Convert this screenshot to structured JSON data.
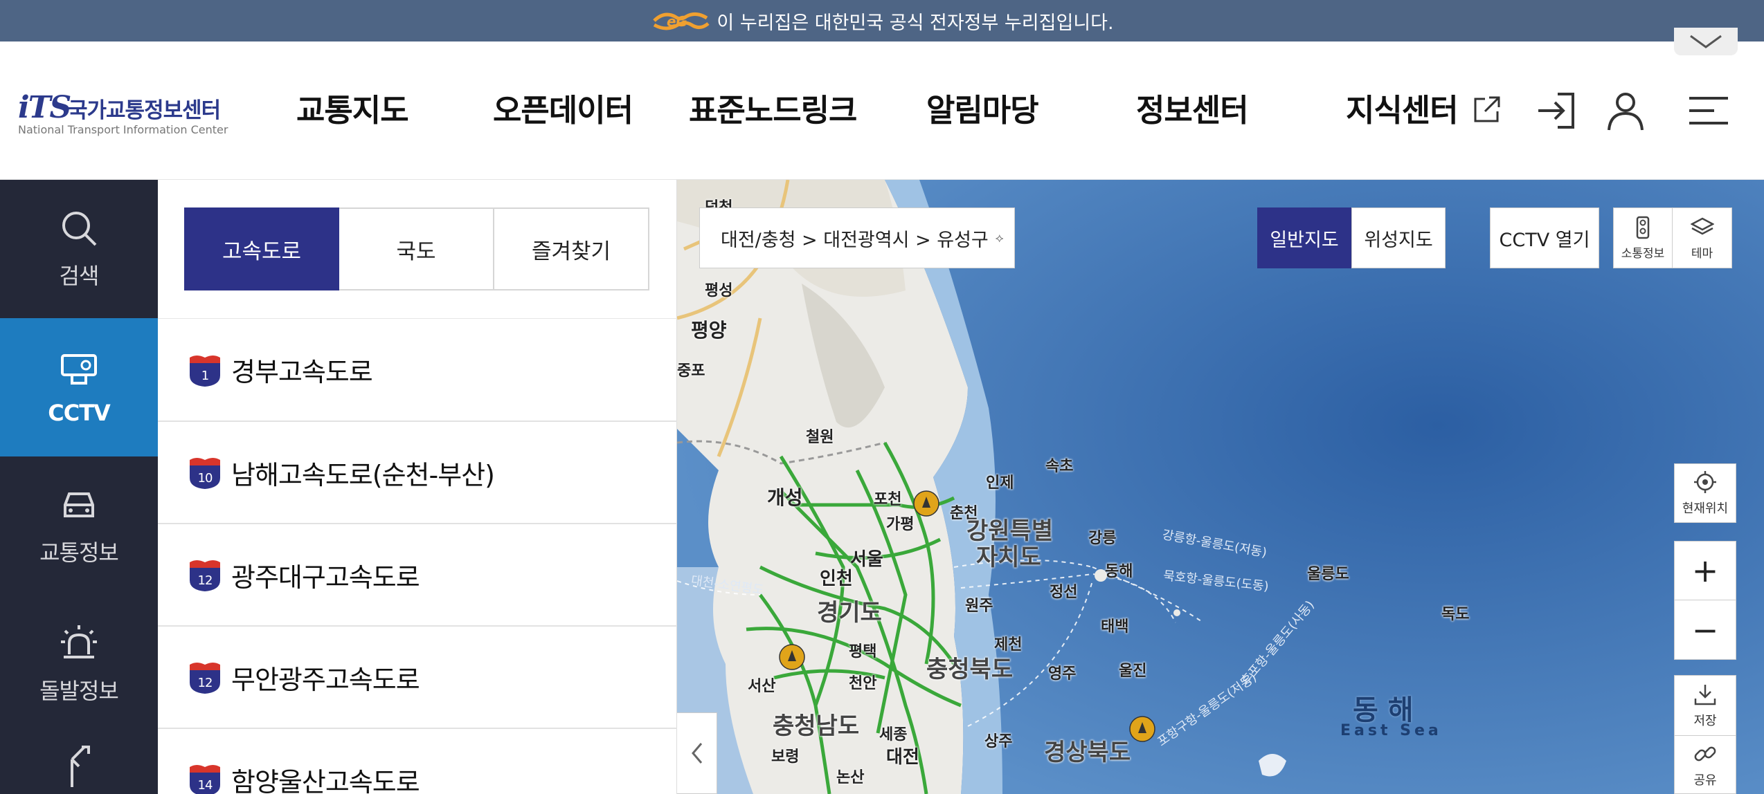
{
  "gov_banner": {
    "text": "이 누리집은 대한민국 공식 전자정부 누리집입니다.",
    "logo_icon": "egov-logo"
  },
  "header": {
    "logo": {
      "mark": "iTS",
      "korean": "국가교통정보센터",
      "english": "National Transport Information Center"
    },
    "nav": [
      "교통지도",
      "오픈데이터",
      "표준노드링크",
      "알림마당",
      "정보센터",
      "지식센터"
    ],
    "icons": [
      "external-link-icon",
      "login-icon",
      "user-icon",
      "menu-icon"
    ]
  },
  "sidebar": {
    "items": [
      {
        "label": "검색",
        "icon": "search-icon"
      },
      {
        "label": "CCTV",
        "icon": "cctv-icon",
        "active": true
      },
      {
        "label": "교통정보",
        "icon": "car-icon"
      },
      {
        "label": "돌발정보",
        "icon": "siren-icon"
      },
      {
        "label": "",
        "icon": "route-icon"
      }
    ]
  },
  "panel": {
    "tabs": [
      {
        "label": "고속도로",
        "active": true
      },
      {
        "label": "국도"
      },
      {
        "label": "즐겨찾기"
      }
    ],
    "roads": [
      {
        "number": "1",
        "name": "경부고속도로"
      },
      {
        "number": "10",
        "name": "남해고속도로(순천-부산)"
      },
      {
        "number": "12",
        "name": "광주대구고속도로"
      },
      {
        "number": "12",
        "name": "무안광주고속도로"
      },
      {
        "number": "14",
        "name": "함양울산고속도로"
      }
    ]
  },
  "map": {
    "breadcrumb": "대전/충청 > 대전광역시 > 유성구",
    "breadcrumb_toggle": "⟡",
    "map_types": [
      {
        "label": "일반지도",
        "active": true
      },
      {
        "label": "위성지도"
      }
    ],
    "cctv_open": "CCTV 열기",
    "tools": [
      {
        "label": "소통정보",
        "icon": "traffic-light-icon"
      },
      {
        "label": "테마",
        "icon": "layers-icon"
      }
    ],
    "right_controls": {
      "current_location": "현재위치",
      "zoom_in": "+",
      "zoom_out": "−",
      "save": "저장",
      "share": "공유"
    },
    "places": [
      "평성",
      "평양",
      "철원",
      "개성",
      "포천",
      "인제",
      "속초",
      "춘천",
      "가평",
      "서울",
      "강원특별",
      "자치도",
      "강릉",
      "인천",
      "동해",
      "정선",
      "울릉도",
      "독도",
      "경기도",
      "원주",
      "태백",
      "제천",
      "평택",
      "충청북도",
      "영주",
      "울진",
      "서산",
      "천안",
      "충청남도",
      "세종",
      "보령",
      "대전",
      "상주",
      "경상북도",
      "논산",
      "동 해",
      "East Sea",
      "중포",
      "덕천"
    ],
    "routes": [
      "강릉항-울릉도(저동)",
      "묵호항-울릉도(도동)",
      "후포항-울릉도(사동)",
      "포항구항-울릉도(저동)",
      "대천-소연평도"
    ],
    "colors": {
      "sea": "#3f74b4",
      "land": "#ececea",
      "road": "#3aa83a",
      "accent": "#2d3288",
      "active_sidebar": "#1e7cbf"
    }
  }
}
